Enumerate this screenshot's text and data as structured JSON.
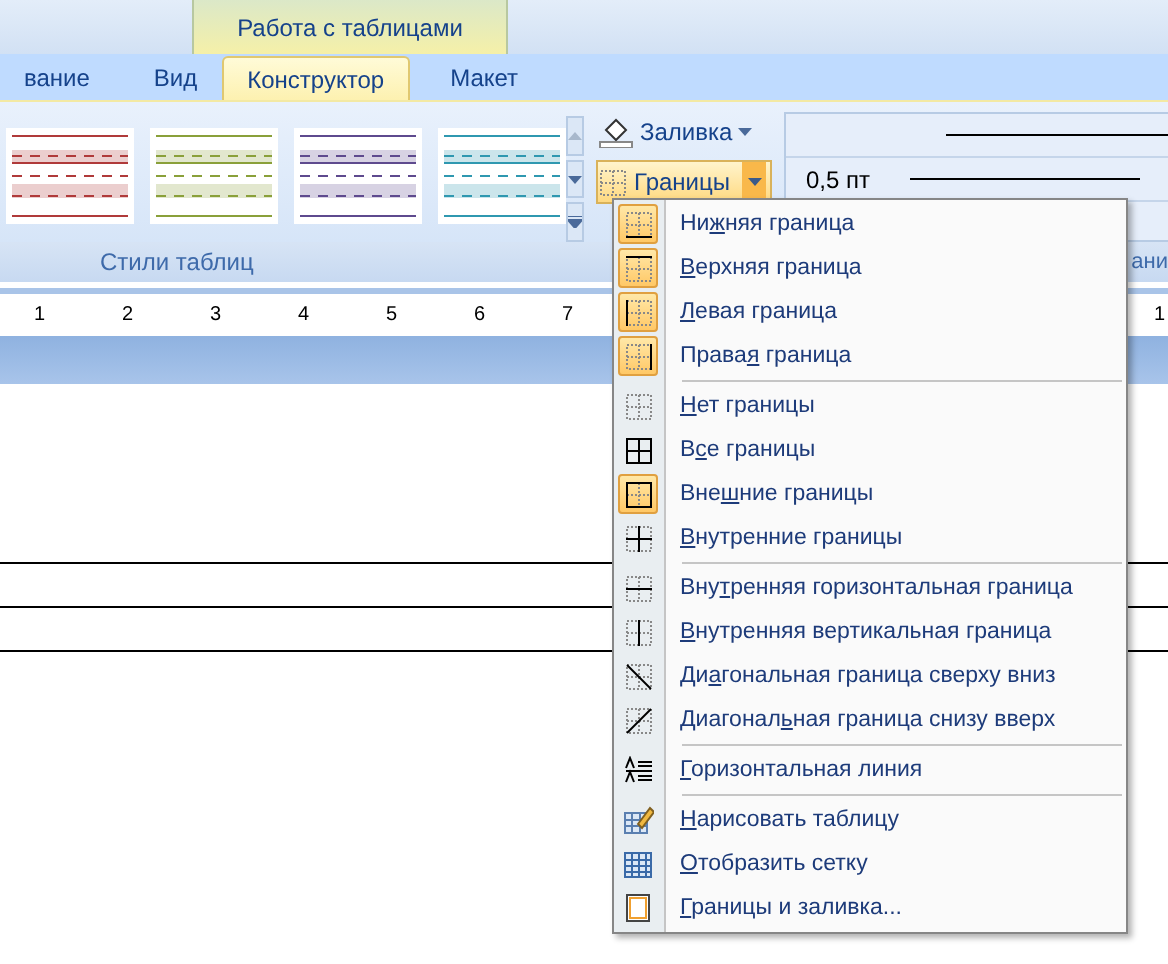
{
  "context_group": {
    "title": "Работа с таблицами"
  },
  "tabs": [
    {
      "label": "вание",
      "selected": false
    },
    {
      "label": "Вид",
      "selected": false
    },
    {
      "label": "Конструктор",
      "selected": true
    },
    {
      "label": "Макет",
      "selected": false
    }
  ],
  "gallery": {
    "styles": [
      {
        "color": "#b03a3a"
      },
      {
        "color": "#8aa03a"
      },
      {
        "color": "#5e4a8e"
      },
      {
        "color": "#2f98b0"
      }
    ],
    "group_label": "Стили таблиц"
  },
  "shading_button": {
    "label": "Заливка"
  },
  "borders_button": {
    "label": "Границы",
    "open": true
  },
  "pen": {
    "weight": "0,5 пт"
  },
  "right_group_label": "ани",
  "ruler": {
    "marks": [
      "1",
      "2",
      "3",
      "4",
      "5",
      "6",
      "7"
    ],
    "right_mark": "1"
  },
  "menu": {
    "sections": [
      [
        {
          "pre": "Ни",
          "key": "ж",
          "post": "няя граница",
          "on": true
        },
        {
          "key": "В",
          "post": "ерхняя граница",
          "on": true
        },
        {
          "key": "Л",
          "post": "евая граница",
          "on": true
        },
        {
          "pre": "Права",
          "key": "я",
          "post": " граница",
          "on": true
        }
      ],
      [
        {
          "key": "Н",
          "post": "ет границы",
          "on": false
        },
        {
          "pre": "В",
          "key": "с",
          "post": "е границы",
          "on": false
        },
        {
          "pre": "Вне",
          "key": "ш",
          "post": "ние границы",
          "on": true
        },
        {
          "key": "В",
          "post": "нутренние границы",
          "on": false
        }
      ],
      [
        {
          "pre": "Вну",
          "key": "т",
          "post": "ренняя горизонтальная граница",
          "on": false
        },
        {
          "key": "В",
          "post": "нутренняя вертикальная граница",
          "on": false
        },
        {
          "pre": "Ди",
          "key": "а",
          "post": "гональная граница сверху вниз",
          "on": false
        },
        {
          "pre": "Диагонал",
          "key": "ь",
          "post": "ная граница снизу вверх",
          "on": false
        }
      ],
      [
        {
          "key": "Г",
          "post": "оризонтальная линия",
          "on": false
        }
      ],
      [
        {
          "key": "Н",
          "post": "арисовать таблицу",
          "on": false
        },
        {
          "key": "О",
          "post": "тобразить сетку",
          "on": false
        },
        {
          "key": "Г",
          "post": "раницы и заливка...",
          "on": false
        }
      ]
    ]
  }
}
